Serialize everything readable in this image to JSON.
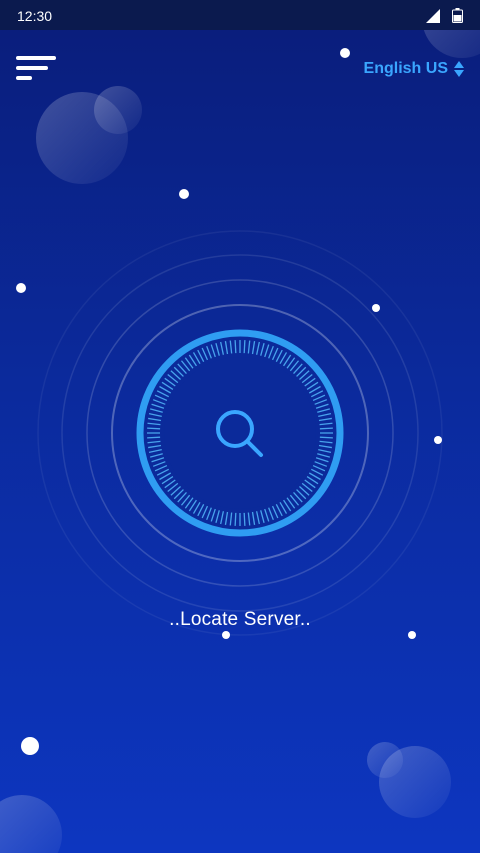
{
  "status_bar": {
    "time": "12:30"
  },
  "header": {
    "language": "English US"
  },
  "main": {
    "status_text": "..Locate Server.."
  },
  "icons": {
    "menu": "menu-icon",
    "language_sort": "sort-updown-icon",
    "search": "search-icon",
    "signal": "signal-icon",
    "battery": "battery-icon"
  },
  "colors": {
    "accent": "#3aa6ff",
    "ring": "#2f9df2",
    "background_top": "#0a1d7a",
    "background_bottom": "#0d36c0",
    "status_bar": "#0b1a4e"
  }
}
